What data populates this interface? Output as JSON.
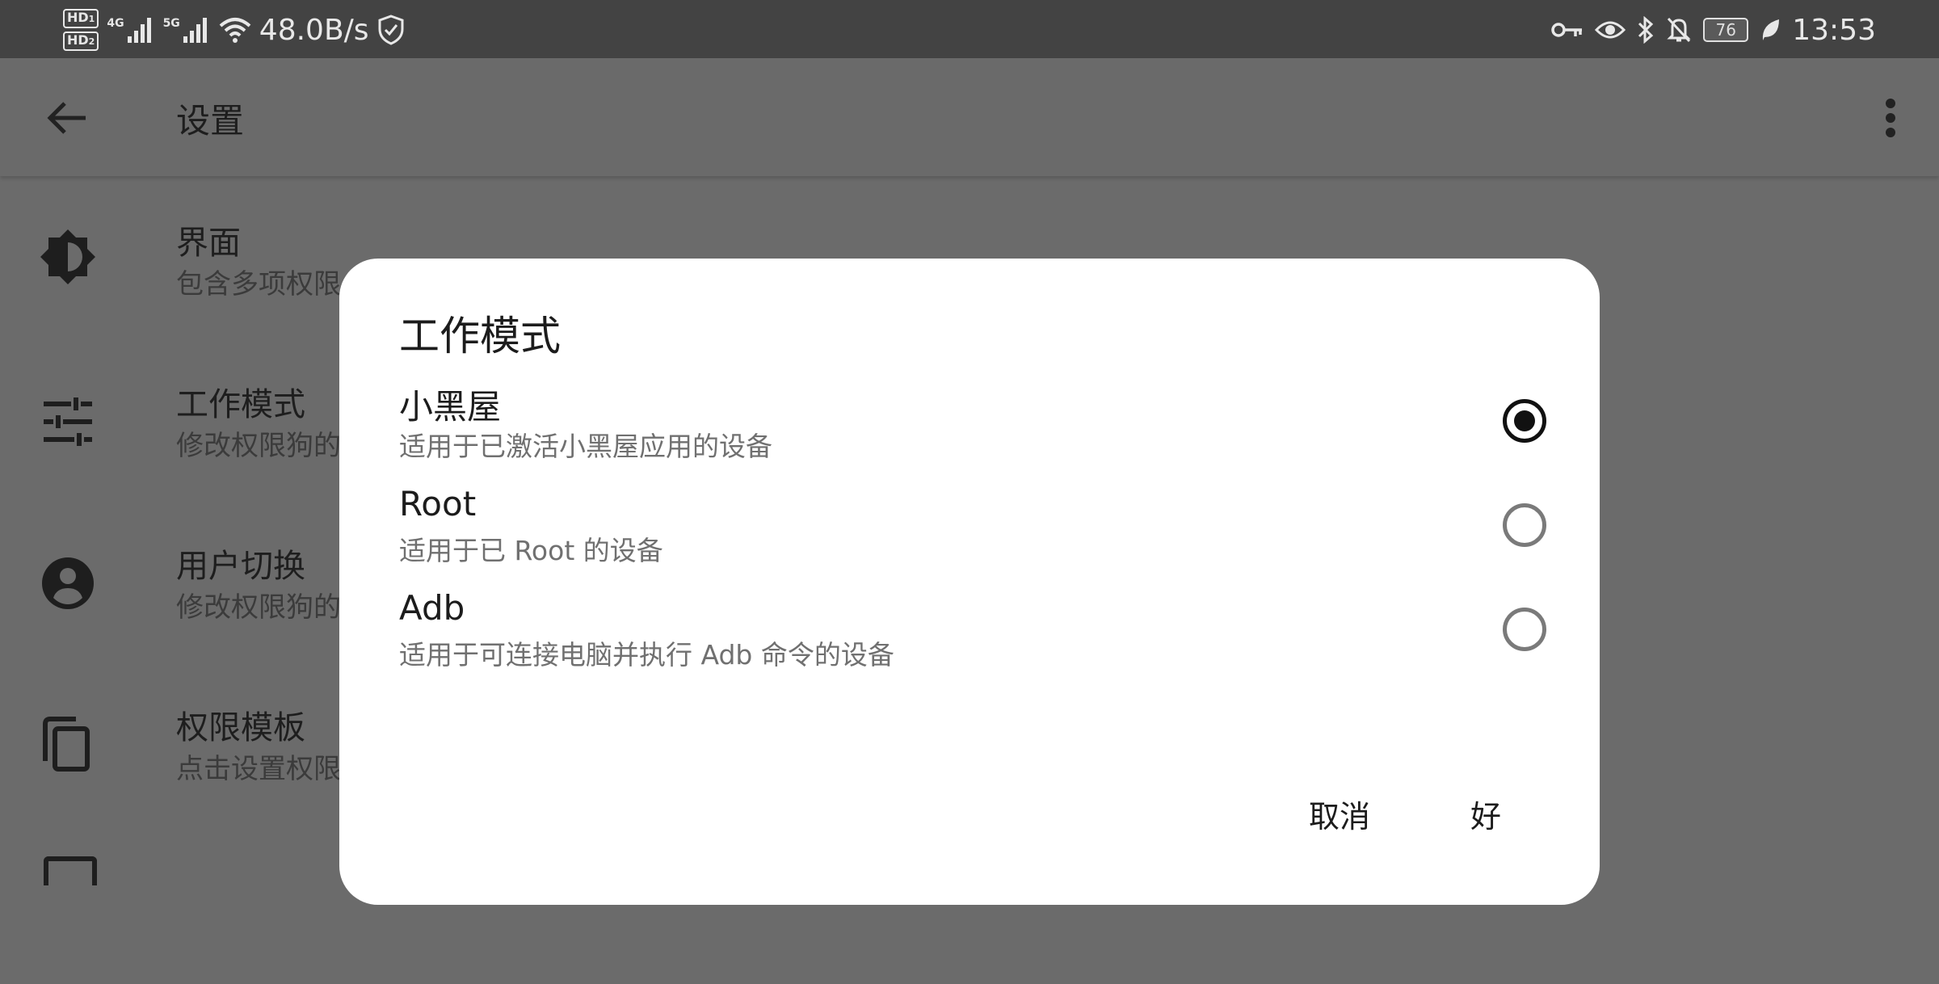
{
  "status_bar": {
    "hd1": "HD",
    "hd1_sub": "1",
    "hd2": "HD",
    "hd2_sub": "2",
    "net1": "4G",
    "net2": "5G",
    "speed": "48.0B/s",
    "battery": "76",
    "time": "13:53",
    "icons": [
      "signal-icon",
      "wifi-icon",
      "shield-check-icon",
      "key-icon",
      "eye-icon",
      "bluetooth-icon",
      "bell-off-icon",
      "battery-icon",
      "leaf-icon"
    ]
  },
  "app_bar": {
    "title": "设置",
    "back_icon": "arrow-left-icon",
    "more_icon": "more-vert-icon"
  },
  "settings_items": [
    {
      "title": "界面",
      "subtitle": "包含多项权限",
      "icon": "brightness-icon"
    },
    {
      "title": "工作模式",
      "subtitle": "修改权限狗的",
      "icon": "tune-icon"
    },
    {
      "title": "用户切换",
      "subtitle": "修改权限狗的",
      "icon": "account-circle-icon"
    },
    {
      "title": "权限模板",
      "subtitle": "点击设置权限",
      "icon": "copy-icon"
    }
  ],
  "dialog": {
    "title": "工作模式",
    "options": [
      {
        "title": "小黑屋",
        "subtitle": "适用于已激活小黑屋应用的设备",
        "selected": true
      },
      {
        "title": "Root",
        "subtitle": "适用于已 Root 的设备",
        "selected": false
      },
      {
        "title": "Adb",
        "subtitle": "适用于可连接电脑并执行 Adb 命令的设备",
        "selected": false
      }
    ],
    "cancel_label": "取消",
    "ok_label": "好"
  }
}
